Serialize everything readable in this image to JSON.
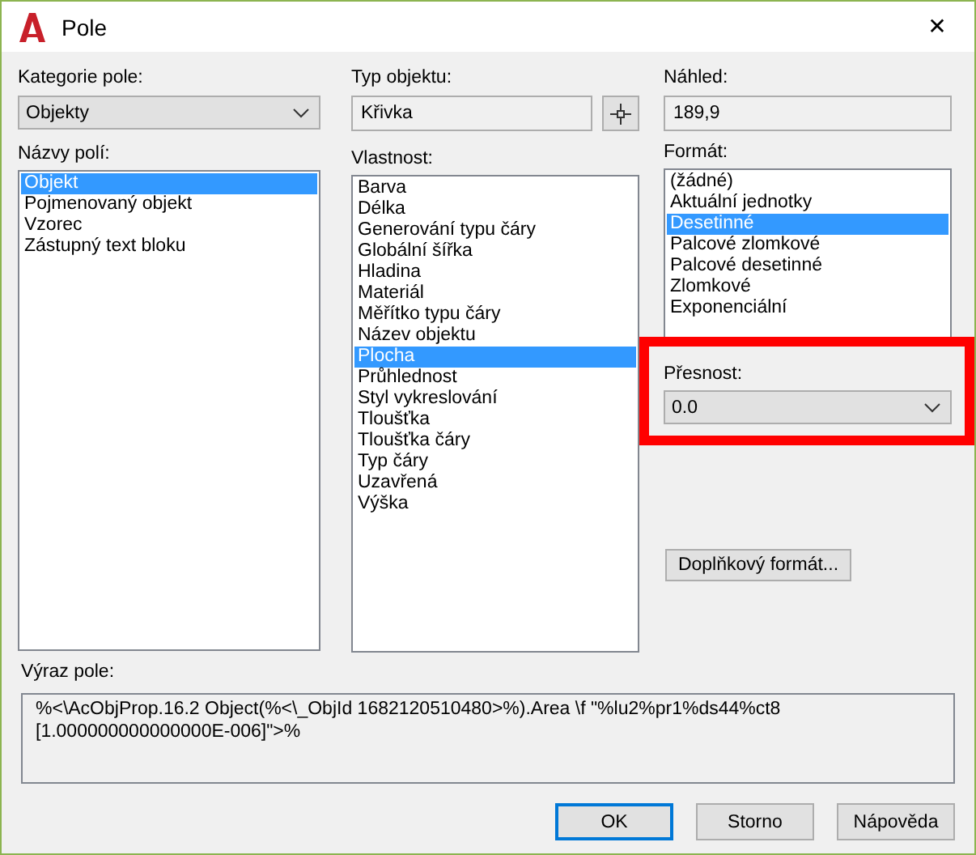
{
  "window": {
    "title": "Pole",
    "close": "✕"
  },
  "field_category": {
    "label": "Kategorie pole:",
    "value": "Objekty"
  },
  "field_names": {
    "label": "Názvy polí:",
    "items": [
      {
        "label": "Objekt",
        "selected": true
      },
      {
        "label": "Pojmenovaný objekt",
        "selected": false
      },
      {
        "label": "Vzorec",
        "selected": false
      },
      {
        "label": "Zástupný text bloku",
        "selected": false
      }
    ]
  },
  "object_type": {
    "label": "Typ objektu:",
    "value": "Křivka"
  },
  "property": {
    "label": "Vlastnost:",
    "items": [
      {
        "label": "Barva",
        "selected": false
      },
      {
        "label": "Délka",
        "selected": false
      },
      {
        "label": "Generování typu čáry",
        "selected": false
      },
      {
        "label": "Globální šířka",
        "selected": false
      },
      {
        "label": "Hladina",
        "selected": false
      },
      {
        "label": "Materiál",
        "selected": false
      },
      {
        "label": "Měřítko typu čáry",
        "selected": false
      },
      {
        "label": "Název objektu",
        "selected": false
      },
      {
        "label": "Plocha",
        "selected": true
      },
      {
        "label": "Průhlednost",
        "selected": false
      },
      {
        "label": "Styl vykreslování",
        "selected": false
      },
      {
        "label": "Tloušťka",
        "selected": false
      },
      {
        "label": "Tloušťka čáry",
        "selected": false
      },
      {
        "label": "Typ čáry",
        "selected": false
      },
      {
        "label": "Uzavřená",
        "selected": false
      },
      {
        "label": "Výška",
        "selected": false
      }
    ]
  },
  "preview": {
    "label": "Náhled:",
    "value": "189,9"
  },
  "format": {
    "label": "Formát:",
    "items": [
      {
        "label": "(žádné)",
        "selected": false
      },
      {
        "label": "Aktuální jednotky",
        "selected": false
      },
      {
        "label": "Desetinné",
        "selected": true
      },
      {
        "label": "Palcové zlomkové",
        "selected": false
      },
      {
        "label": "Palcové desetinné",
        "selected": false
      },
      {
        "label": "Zlomkové",
        "selected": false
      },
      {
        "label": "Exponenciální",
        "selected": false
      }
    ]
  },
  "precision": {
    "label": "Přesnost:",
    "value": "0.0",
    "highlighted": true
  },
  "additional_format_button": "Doplňkový formát...",
  "field_expression": {
    "label": "Výraz pole:",
    "value": "%<\\AcObjProp.16.2 Object(%<\\_ObjId 1682120510480>%).Area \\f \"%lu2%pr1%ds44%ct8\n[1.000000000000000E-006]\">%"
  },
  "buttons": [
    {
      "label": "OK",
      "default": true
    },
    {
      "label": "Storno",
      "default": false
    },
    {
      "label": "Nápověda",
      "default": false
    }
  ]
}
